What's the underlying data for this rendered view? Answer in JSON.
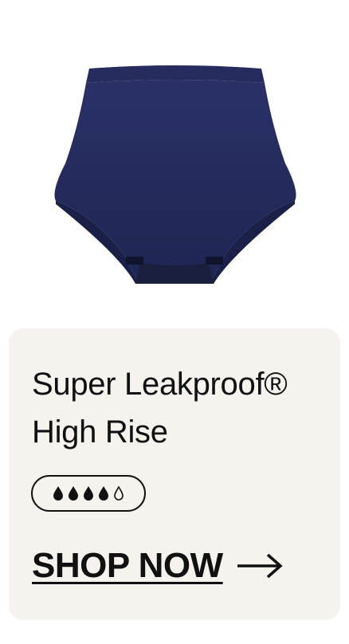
{
  "product": {
    "title_line1": "Super Leakproof®",
    "title_line2": "High Rise",
    "absorbency": {
      "filled_drops": 4,
      "total_drops": 5
    },
    "image_icon": "navy-high-rise-brief-image",
    "colors": {
      "garment": "#232a5a",
      "card_bg": "#f6f3ef",
      "text": "#111111"
    }
  },
  "cta": {
    "label": "SHOP NOW",
    "icon": "arrow-right-icon"
  }
}
